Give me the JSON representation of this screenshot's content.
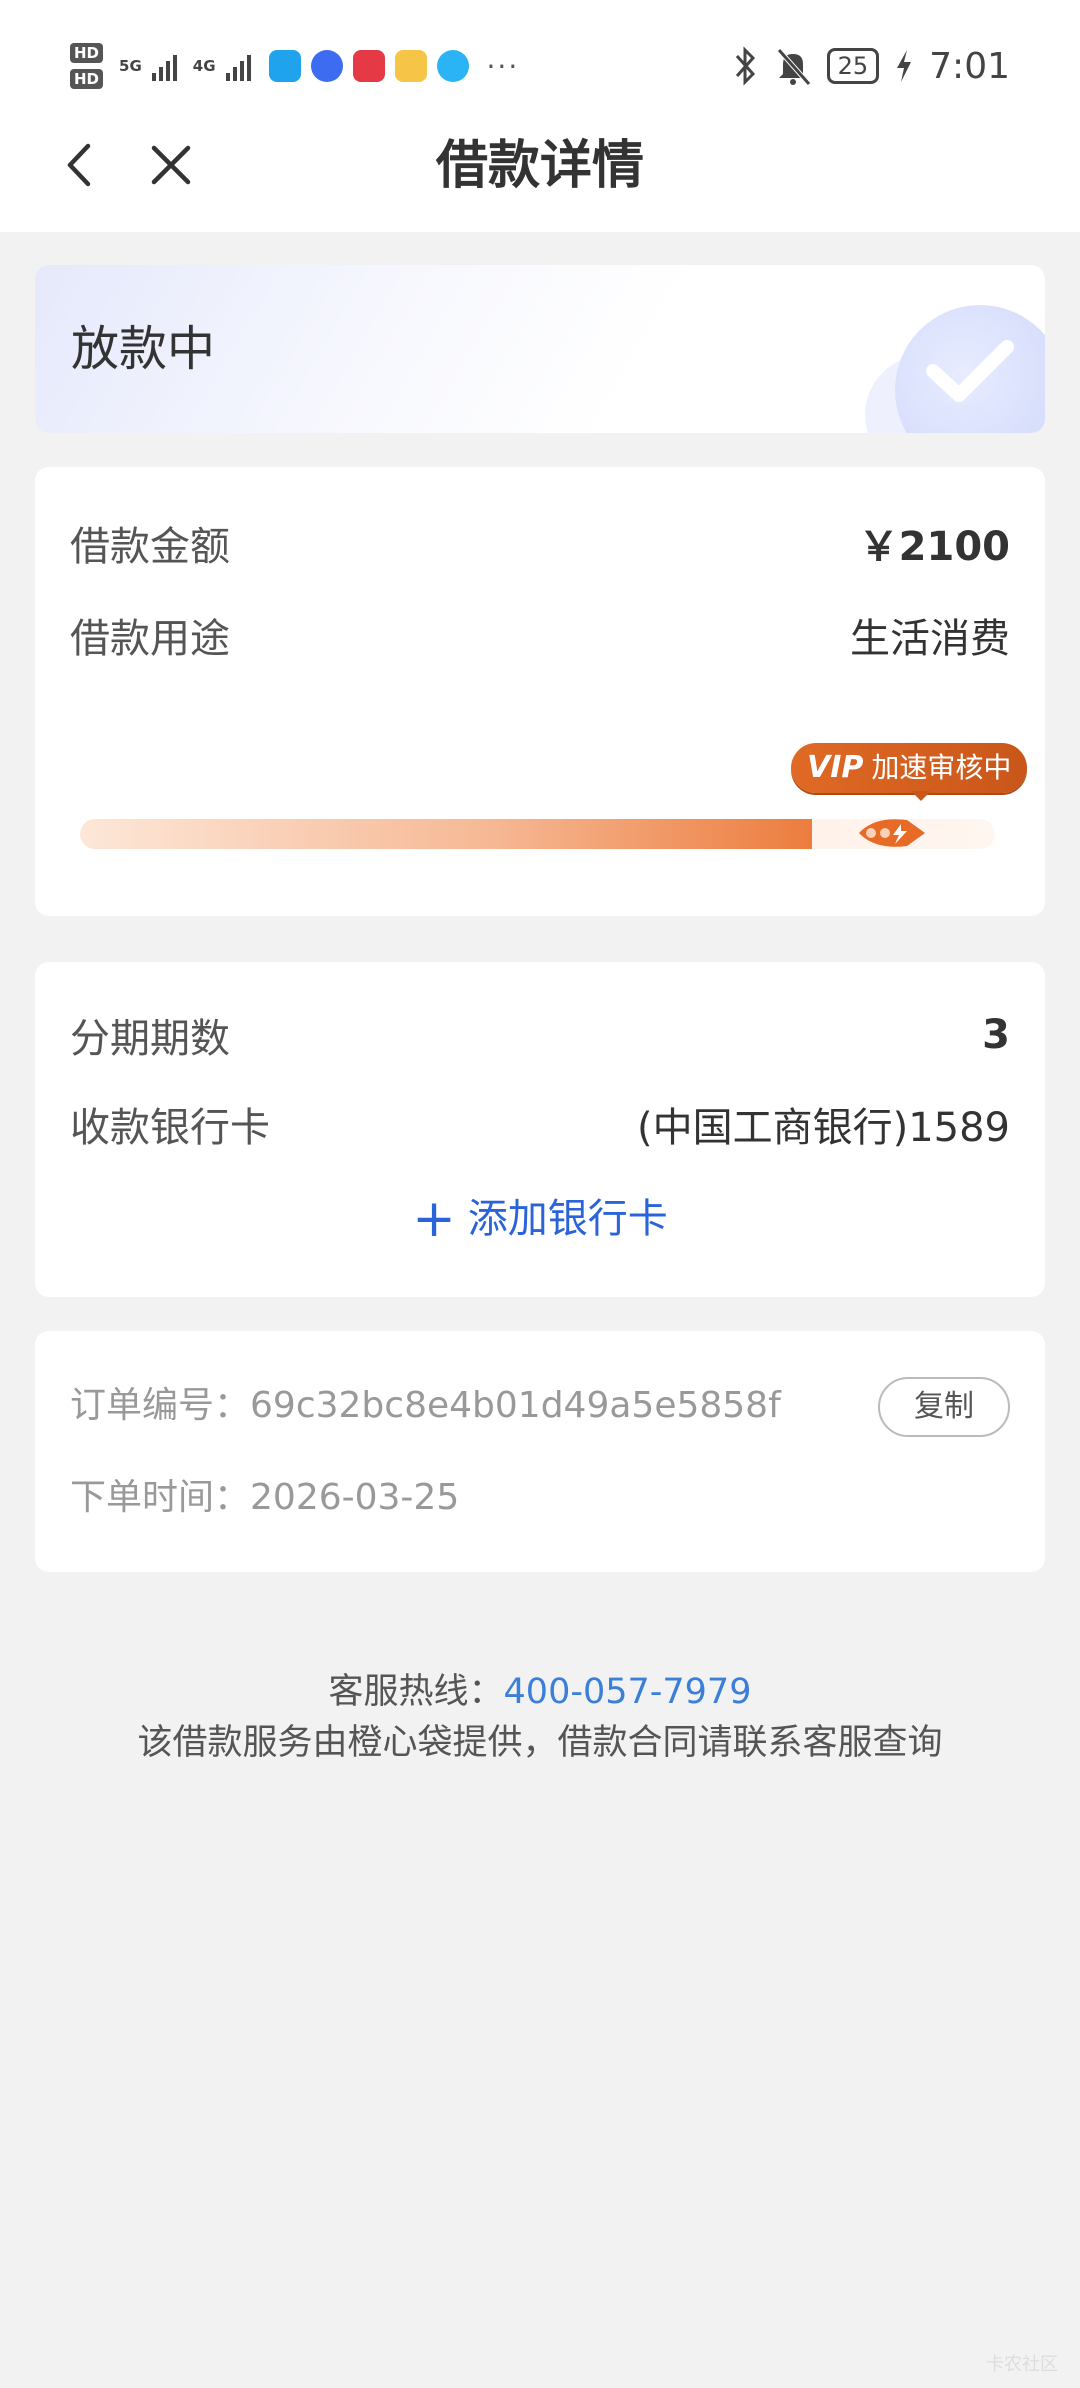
{
  "statusbar": {
    "hd1": "HD",
    "hd2": "HD",
    "net1": "5G",
    "net2": "4G",
    "more": "···",
    "battery": "25",
    "time": "7:01",
    "icons": [
      "bluetooth-icon",
      "mute-icon",
      "battery-icon",
      "charging-icon"
    ]
  },
  "nav": {
    "title": "借款详情",
    "back_icon": "chevron-left-icon",
    "close_icon": "close-icon"
  },
  "status": {
    "text": "放款中",
    "icon": "check-icon"
  },
  "loan": {
    "amount_label": "借款金额",
    "amount_value": "￥2100",
    "purpose_label": "借款用途",
    "purpose_value": "生活消费",
    "progress": 0.86,
    "badge_mark": "VIP",
    "badge_text": "加速审核中"
  },
  "bank": {
    "installments_label": "分期期数",
    "installments_value": "3",
    "card_label": "收款银行卡",
    "card_value": "(中国工商银行)1589",
    "add_card_plus": "+",
    "add_card_text": "添加银行卡"
  },
  "order": {
    "number_label": "订单编号：",
    "number_value": "69c32bc8e4b01d49a5e5858f",
    "copy_label": "复制",
    "time_label": "下单时间：",
    "time_value": "2026-03-25"
  },
  "footer": {
    "hotline_label": "客服热线：",
    "hotline_number": "400-057-7979",
    "note": "该借款服务由橙心袋提供，借款合同请联系客服查询"
  },
  "colors": {
    "accent_blue": "#2b64d9",
    "vip_orange": "#e06a25",
    "background": "#f2f2f2"
  },
  "watermark": "卡农社区"
}
